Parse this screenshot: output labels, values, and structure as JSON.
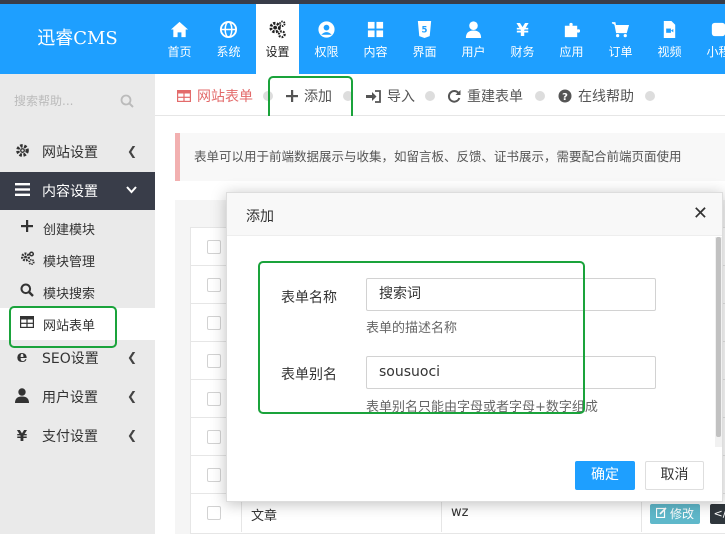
{
  "app": {
    "logo": "迅睿CMS"
  },
  "nav": {
    "items": [
      {
        "label": "首页",
        "icon": "home-icon"
      },
      {
        "label": "系统",
        "icon": "globe-icon"
      },
      {
        "label": "设置",
        "icon": "cogs-icon",
        "active": true
      },
      {
        "label": "权限",
        "icon": "user-circle-icon"
      },
      {
        "label": "内容",
        "icon": "grid-icon"
      },
      {
        "label": "界面",
        "icon": "html5-icon"
      },
      {
        "label": "用户",
        "icon": "user-icon"
      },
      {
        "label": "财务",
        "icon": "yen-icon"
      },
      {
        "label": "应用",
        "icon": "puzzle-icon"
      },
      {
        "label": "订单",
        "icon": "cart-icon"
      },
      {
        "label": "视频",
        "icon": "file-video-icon"
      },
      {
        "label": "小程",
        "icon": "app-icon"
      }
    ]
  },
  "sidebar": {
    "search_placeholder": "搜索帮助...",
    "menus": [
      {
        "label": "网站设置",
        "icon": "gear-icon"
      },
      {
        "label": "内容设置",
        "icon": "bars-icon",
        "open": true
      },
      {
        "label": "SEO设置",
        "icon": "ie-icon"
      },
      {
        "label": "用户设置",
        "icon": "user-icon"
      },
      {
        "label": "支付设置",
        "icon": "yen-icon"
      }
    ],
    "sub": [
      {
        "label": "创建模块",
        "icon": "plus-icon"
      },
      {
        "label": "模块管理",
        "icon": "cogs-icon"
      },
      {
        "label": "模块搜索",
        "icon": "search-icon"
      },
      {
        "label": "网站表单",
        "icon": "table-icon",
        "current": true
      }
    ]
  },
  "tabs": [
    {
      "label": "网站表单",
      "icon": "table-icon",
      "active": true
    },
    {
      "label": "添加",
      "icon": "plus-icon"
    },
    {
      "label": "导入",
      "icon": "sign-in-icon"
    },
    {
      "label": "重建表单",
      "icon": "refresh-icon"
    },
    {
      "label": "在线帮助",
      "icon": "question-circle-icon"
    }
  ],
  "alert": {
    "text": "表单可以用于前端数据展示与收集，如留言板、反馈、证书展示，需要配合前端页面使用"
  },
  "table": {
    "last_row": {
      "name": "文章",
      "alias": "wz",
      "edit_label": "修改",
      "code_label": "</"
    }
  },
  "modal": {
    "title": "添加",
    "close": "✕",
    "fields": [
      {
        "label": "表单名称",
        "value": "搜索词",
        "hint": "表单的描述名称"
      },
      {
        "label": "表单别名",
        "value": "sousuoci",
        "hint": "表单别名只能由字母或者字母+数字组成"
      }
    ],
    "ok_label": "确定",
    "cancel_label": "取消"
  },
  "colors": {
    "accent": "#1e9fff",
    "highlight_box": "#1aa33b",
    "active_tab": "#e36b6b",
    "sidebar_open": "#393d49"
  }
}
